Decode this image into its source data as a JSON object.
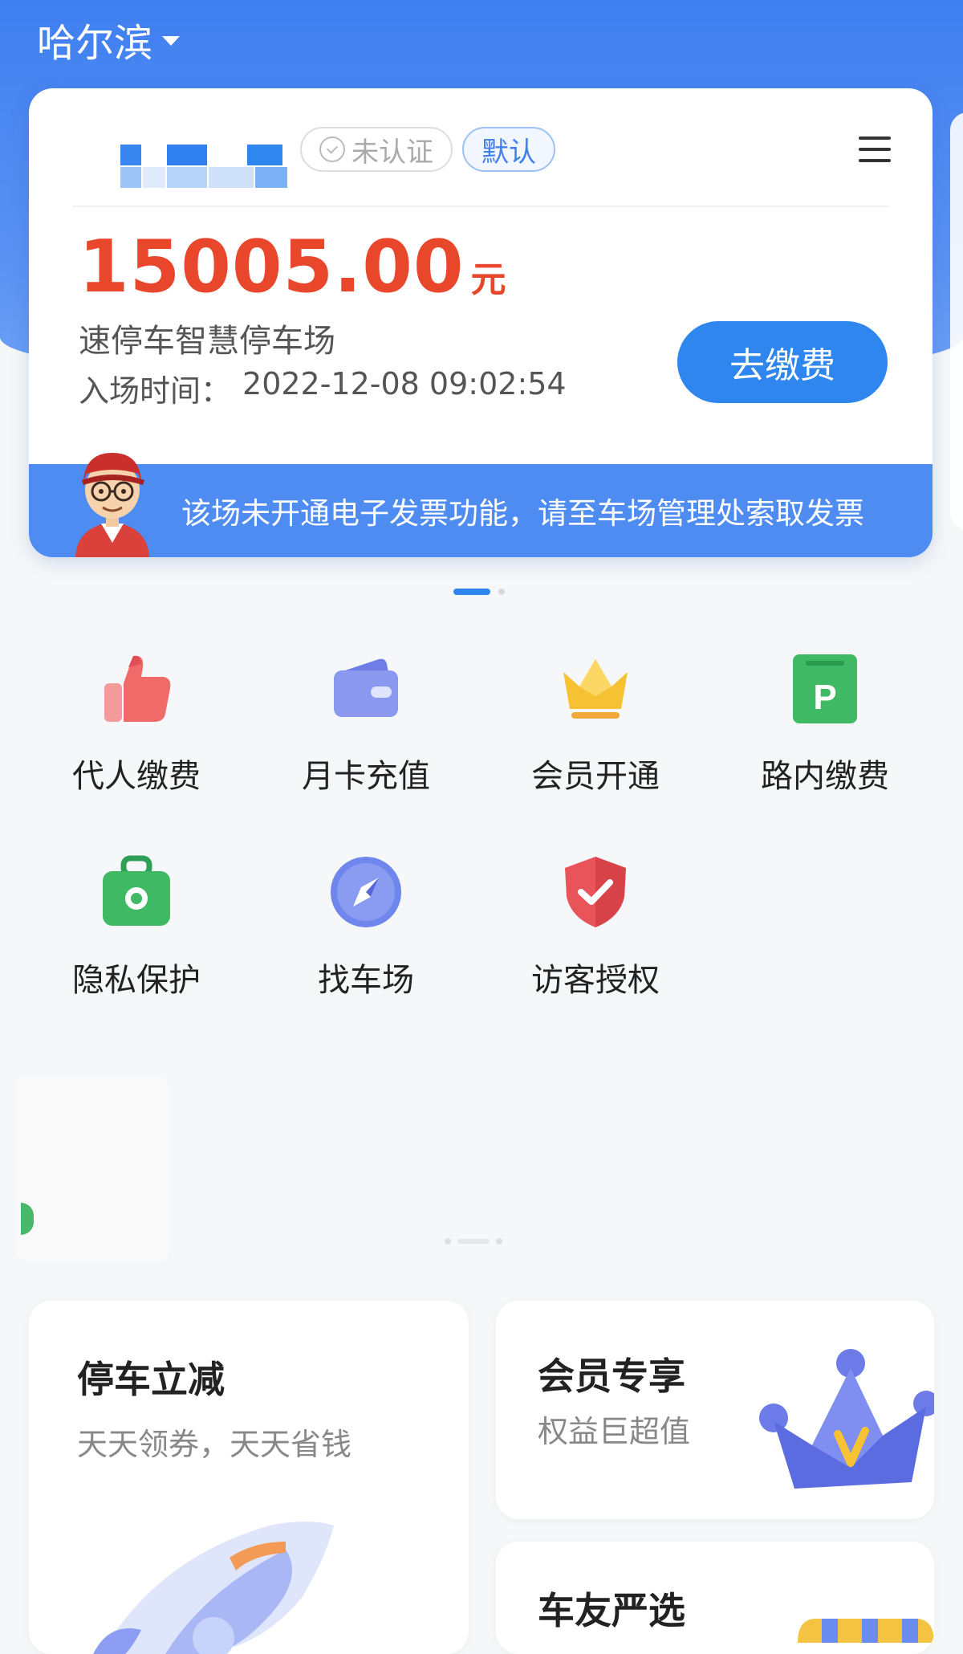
{
  "header": {
    "city": "哈尔滨"
  },
  "parking_card": {
    "verify_status": "未认证",
    "default_tag": "默认",
    "amount": "15005.00",
    "currency_unit": "元",
    "lot_name": "速停车智慧停车场",
    "entry_label": "入场时间：",
    "entry_time": "2022-12-08 09:02:54",
    "pay_button": "去缴费",
    "notice": "该场未开通电子发票功能，请至车场管理处索取发票"
  },
  "services": [
    {
      "label": "代人缴费",
      "icon": "thumbs-up-icon"
    },
    {
      "label": "月卡充值",
      "icon": "wallet-icon"
    },
    {
      "label": "会员开通",
      "icon": "crown-icon"
    },
    {
      "label": "路内缴费",
      "icon": "parking-sign-icon"
    },
    {
      "label": "隐私保护",
      "icon": "privacy-bag-icon"
    },
    {
      "label": "找车场",
      "icon": "compass-icon"
    },
    {
      "label": "访客授权",
      "icon": "shield-check-icon"
    }
  ],
  "promos": {
    "parking_discount": {
      "title": "停车立减",
      "subtitle": "天天领券，天天省钱"
    },
    "member": {
      "title": "会员专享",
      "subtitle": "权益巨超值"
    },
    "selection": {
      "title": "车友严选"
    }
  },
  "colors": {
    "brand_blue": "#2f86ee",
    "amount_red": "#e8472b",
    "header_blue": "#3f7ff0"
  }
}
